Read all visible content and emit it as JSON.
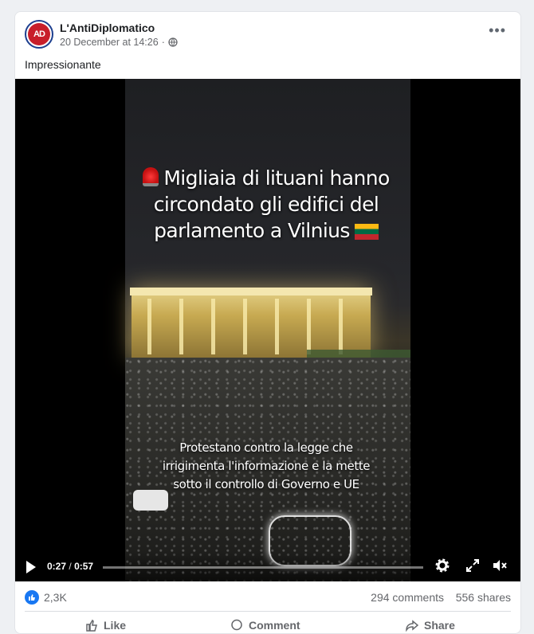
{
  "post": {
    "page_name": "L'AntiDiplomatico",
    "avatar_text": "AD",
    "timestamp": "20 December at 14:26",
    "audience_icon": "globe-icon",
    "more_icon": "more-options-icon",
    "caption": "Impressionante"
  },
  "video": {
    "overlay_title_lines": [
      "Migliaia di lituani hanno",
      "circondato gli edifici del",
      "parlamento a Vilnius"
    ],
    "overlay_subtitle_lines": [
      "Protestano contro la legge che",
      "irrigimenta l'informazione e la mette",
      "sotto il controllo di Governo e UE"
    ],
    "current_time": "0:27",
    "separator": "/",
    "duration": "0:57",
    "progress_fraction": 0.0,
    "icons": [
      "play-icon",
      "settings-icon",
      "fullscreen-icon",
      "mute-icon"
    ]
  },
  "stats": {
    "reactions": "2,3K",
    "comments": "294 comments",
    "shares": "556 shares"
  },
  "actions": {
    "like": "Like",
    "comment": "Comment",
    "share": "Share"
  },
  "colors": {
    "brand": "#1877f2",
    "text": "#1c1e21",
    "muted": "#65676b"
  }
}
